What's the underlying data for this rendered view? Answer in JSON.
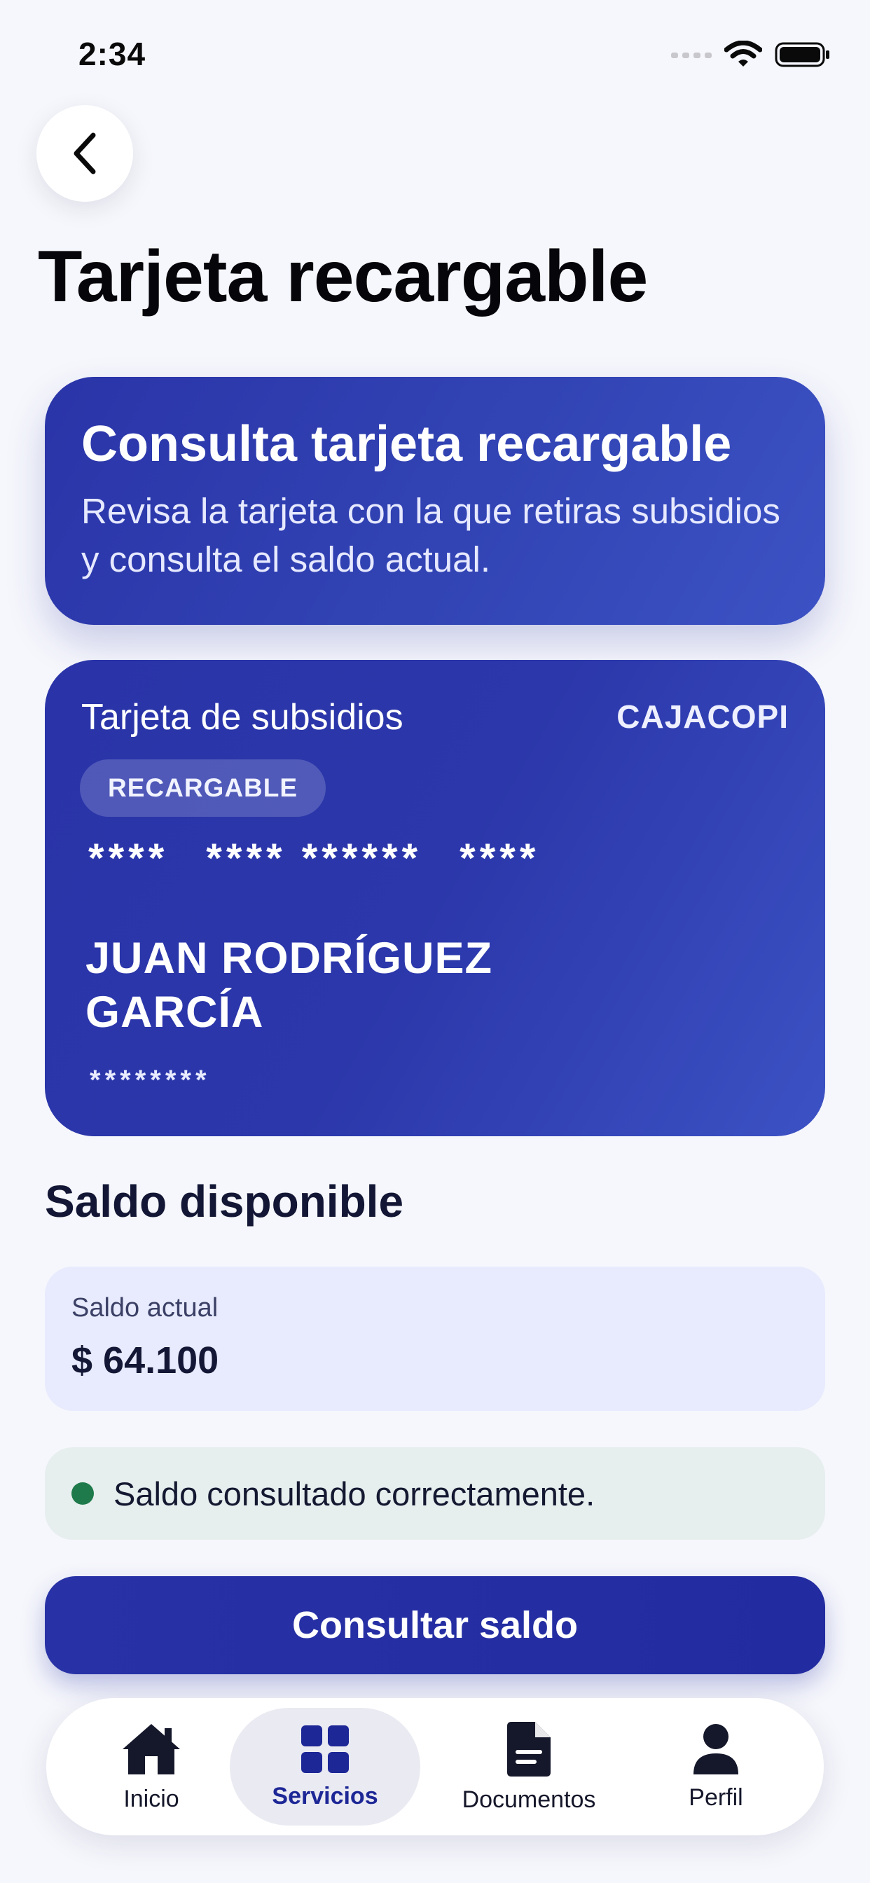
{
  "status_bar": {
    "time": "2:34"
  },
  "header": {
    "title": "Tarjeta recargable",
    "back_icon": "chevron-left-icon"
  },
  "info_card": {
    "title": "Consulta tarjeta recargable",
    "description": "Revisa la tarjeta con la que retiras subsidios y consulta el saldo actual."
  },
  "subsidy_card": {
    "label": "Tarjeta de subsidios",
    "brand": "CAJACOPI",
    "chip": "RECARGABLE",
    "number_groups": [
      "****",
      "**** ******",
      "****"
    ],
    "holder_name": "JUAN RODRÍGUEZ GARCÍA",
    "masked_code": "********"
  },
  "balance": {
    "section_title": "Saldo disponible",
    "label": "Saldo actual",
    "value": "$ 64.100"
  },
  "status_message": {
    "text": "Saldo consultado correctamente.",
    "color": "#1e7a4a"
  },
  "primary_action": {
    "label": "Consultar saldo"
  },
  "bottom_nav": {
    "items": [
      {
        "label": "Inicio",
        "icon": "home-icon",
        "active": false
      },
      {
        "label": "Servicios",
        "icon": "grid-icon",
        "active": true
      },
      {
        "label": "Documentos",
        "icon": "document-icon",
        "active": false
      },
      {
        "label": "Perfil",
        "icon": "user-icon",
        "active": false
      }
    ]
  },
  "colors": {
    "brand_blue": "#2a34a8",
    "background": "#f6f7fc",
    "active_nav": "#1d2796"
  }
}
